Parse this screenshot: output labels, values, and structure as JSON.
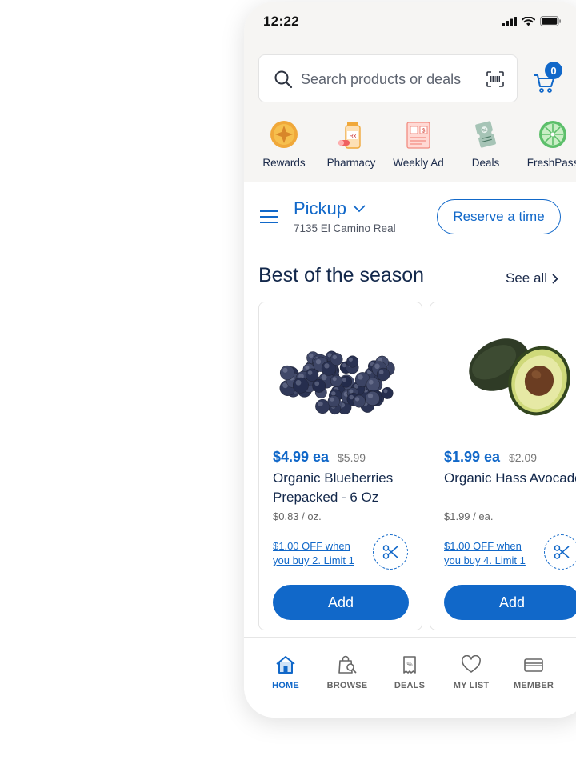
{
  "status": {
    "time": "12:22"
  },
  "search": {
    "placeholder": "Search products or deals"
  },
  "cart": {
    "count": "0"
  },
  "categories": [
    {
      "label": "Rewards",
      "icon": "rewards-star-icon"
    },
    {
      "label": "Pharmacy",
      "icon": "pharmacy-pill-icon"
    },
    {
      "label": "Weekly Ad",
      "icon": "weekly-ad-icon"
    },
    {
      "label": "Deals",
      "icon": "deals-ticket-icon"
    },
    {
      "label": "FreshPass",
      "icon": "freshpass-lime-icon"
    }
  ],
  "pickup": {
    "label": "Pickup",
    "address": "7135 El Camino Real",
    "reserve_label": "Reserve a time"
  },
  "section": {
    "title": "Best of the season",
    "see_all": "See all"
  },
  "products": [
    {
      "price": "$4.99 ea",
      "old_price": "$5.99",
      "name": "Organic Blueberries Prepacked - 6 Oz",
      "unit_price": "$0.83 / oz.",
      "deal": "$1.00 OFF when you buy 2. Limit 1",
      "add_label": "Add"
    },
    {
      "price": "$1.99 ea",
      "old_price": "$2.09",
      "name": "Organic Hass Avocado",
      "unit_price": "$1.99 / ea.",
      "deal": "$1.00 OFF when you buy 4. Limit 1",
      "add_label": "Add"
    }
  ],
  "nav": [
    {
      "label": "HOME",
      "active": true
    },
    {
      "label": "BROWSE"
    },
    {
      "label": "DEALS"
    },
    {
      "label": "MY LIST"
    },
    {
      "label": "MEMBER"
    }
  ],
  "colors": {
    "accent": "#1168c9",
    "top_background": "#f6f5f3",
    "title": "#13284b"
  }
}
